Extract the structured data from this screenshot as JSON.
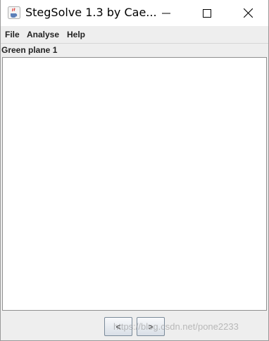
{
  "window": {
    "title": "StegSolve 1.3 by Cae...",
    "icon": "java-cup-icon",
    "controls": {
      "minimize": "minimize-icon",
      "maximize": "maximize-icon",
      "close": "close-icon"
    }
  },
  "menubar": {
    "items": [
      "File",
      "Analyse",
      "Help"
    ]
  },
  "panel": {
    "label": "Green plane 1"
  },
  "navigation": {
    "prev_label": "<",
    "next_label": ">"
  },
  "watermark": {
    "text": "https://blog.csdn.net/pone2233"
  }
}
